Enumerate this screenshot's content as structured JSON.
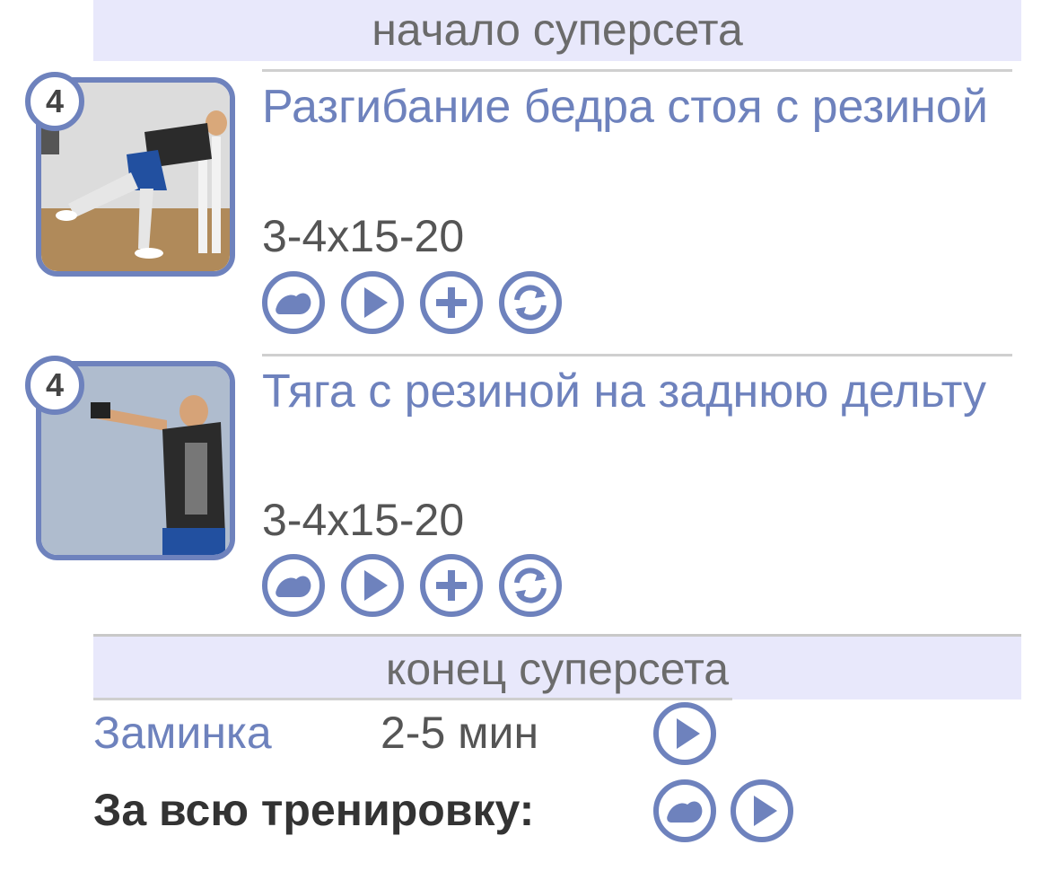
{
  "superset": {
    "start_label": "начало суперсета",
    "end_label": "конец суперсета"
  },
  "exercises": [
    {
      "badge": "4",
      "title": "Разгибание бедра стоя с резиной",
      "reps": "3-4x15-20",
      "actions": [
        "muscle-icon",
        "play-icon",
        "add-icon",
        "replace-icon"
      ]
    },
    {
      "badge": "4",
      "title": "Тяга с резиной на заднюю дельту",
      "reps": "3-4x15-20",
      "actions": [
        "muscle-icon",
        "play-icon",
        "add-icon",
        "replace-icon"
      ]
    }
  ],
  "cooldown": {
    "label": "Заминка",
    "duration": "2-5 мин"
  },
  "total": {
    "label": "За всю тренировку:"
  },
  "colors": {
    "accent": "#6e82bd",
    "band": "#e8e8fb",
    "text_gray": "#555555"
  }
}
